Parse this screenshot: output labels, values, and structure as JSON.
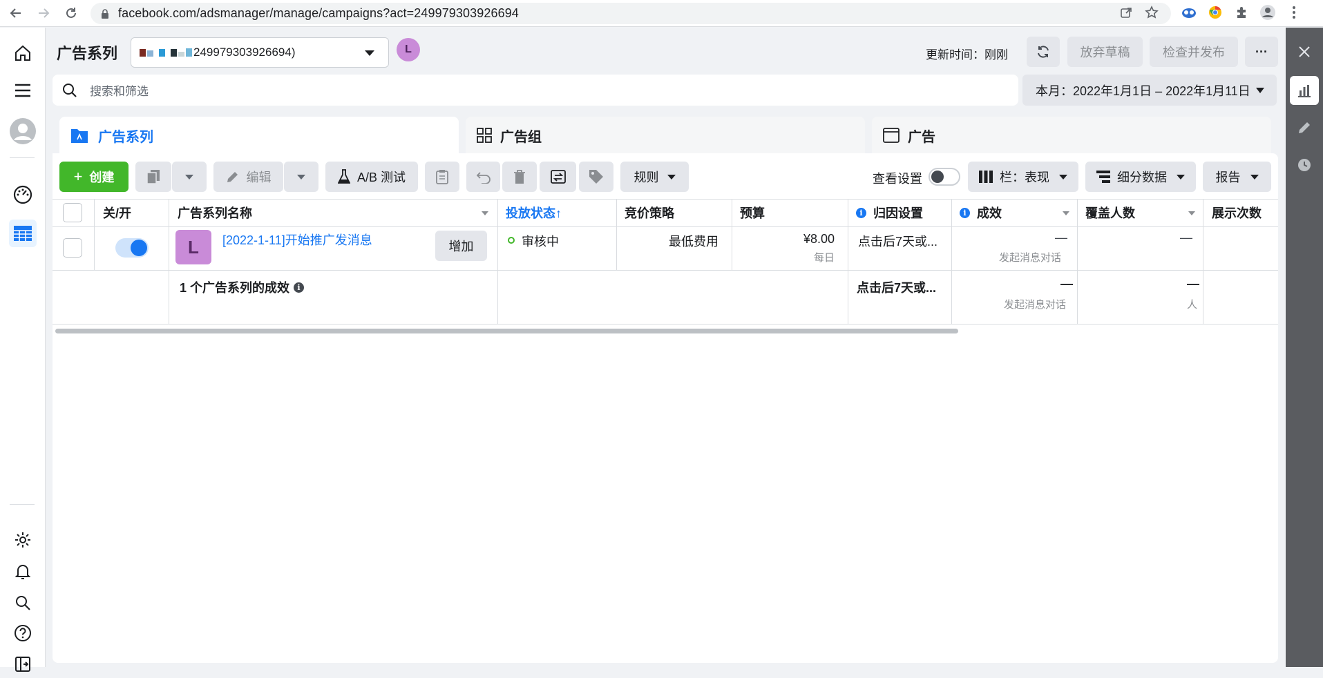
{
  "browser": {
    "url": "facebook.com/adsmanager/manage/campaigns?act=249979303926694"
  },
  "header": {
    "title": "广告系列",
    "account_text": "249979303926694)",
    "avatar_letter": "L",
    "update_label": "更新时间：刚刚",
    "discard_label": "放弃草稿",
    "review_label": "检查并发布",
    "more_label": "···"
  },
  "search": {
    "placeholder": "搜索和筛选",
    "date_range": "本月：2022年1月1日 – 2022年1月11日"
  },
  "tabs": [
    {
      "label": "广告系列"
    },
    {
      "label": "广告组"
    },
    {
      "label": "广告"
    }
  ],
  "toolbar": {
    "create_label": "创建",
    "edit_label": "编辑",
    "ab_label": "A/B 测试",
    "rules_label": "规则",
    "view_settings_label": "查看设置",
    "columns_label": "栏：表现",
    "breakdown_label": "细分数据",
    "reports_label": "报告"
  },
  "table": {
    "headers": {
      "toggle": "关/开",
      "name": "广告系列名称",
      "delivery": "投放状态↑",
      "bid": "竞价策略",
      "budget": "预算",
      "attribution": "归因设置",
      "results": "成效",
      "reach": "覆盖人数",
      "impressions": "展示次数"
    },
    "row": {
      "avatar_letter": "L",
      "name": "[2022-1-11]开始推广发消息",
      "add_label": "增加",
      "delivery": "审核中",
      "bid": "最低费用",
      "budget": "¥8.00",
      "budget_period": "每日",
      "attribution": "点击后7天或...",
      "results": "—",
      "results_sub": "发起消息对话",
      "reach": "—"
    },
    "summary": {
      "label": "1 个广告系列的成效",
      "attribution": "点击后7天或...",
      "results": "—",
      "results_sub": "发起消息对话",
      "reach": "—",
      "reach_sub": "人"
    }
  },
  "colors": {
    "accent": "#1877f2",
    "create": "#42b72a",
    "right_panel": "#5a5c60"
  }
}
